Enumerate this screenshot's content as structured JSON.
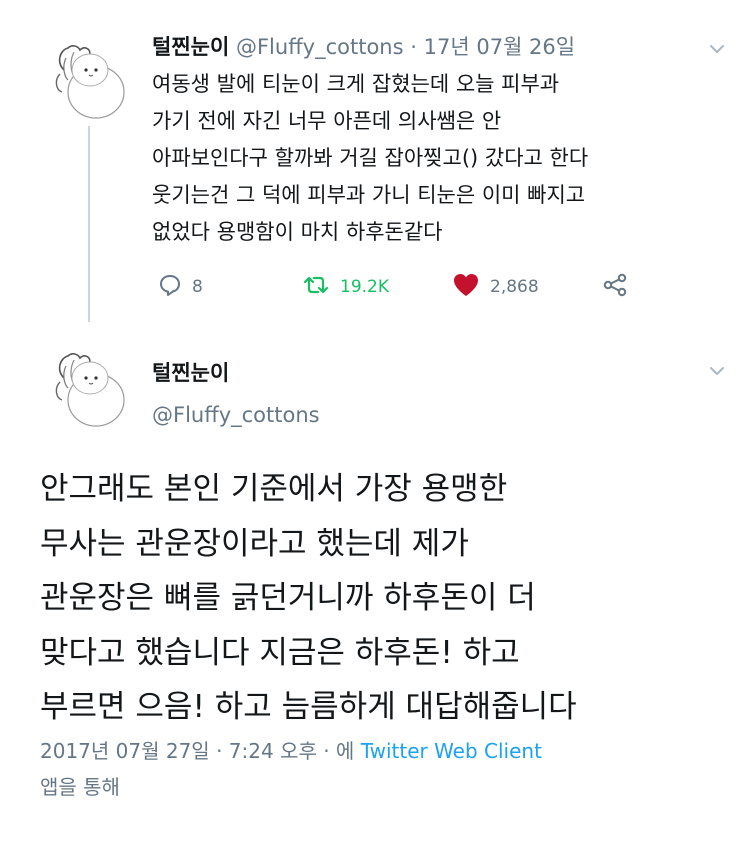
{
  "tweet1": {
    "name": "털찐눈이",
    "handle": "@Fluffy_cottons",
    "separator": "·",
    "date": "17년 07월 26일",
    "lines": [
      "여동생 발에 티눈이 크게 잡혔는데 오늘 피부과",
      "가기 전에 자긴 너무 아픈데 의사쌤은 안",
      "아파보인다구 할까봐 거길 잡아찢고() 갔다고 한다",
      "웃기는건 그 덕에 피부과 가니 티눈은 이미 빠지고",
      "없었다 용맹함이 마치 하후돈같다"
    ],
    "actions": {
      "reply_count": "8",
      "retweet_count": "19.2K",
      "like_count": "2,868"
    },
    "colors": {
      "retweet": "#17bf63",
      "like": "#c4122e"
    }
  },
  "tweet2": {
    "name": "털찐눈이",
    "handle": "@Fluffy_cottons",
    "lines": [
      "안그래도 본인 기준에서 가장 용맹한",
      "무사는 관운장이라고 했는데 제가",
      "관운장은 뼈를 긁던거니까 하후돈이 더",
      "맞다고 했습니다 지금은 하후돈! 하고",
      "부르면 으음! 하고 늠름하게 대답해줍니다"
    ],
    "meta": {
      "timestamp": "2017년 07월 27일 · 7:24 오후 · 에",
      "client": "Twitter Web Client",
      "suffix": "앱을 통해"
    }
  },
  "icons": [
    "reply-icon",
    "retweet-icon",
    "heart-icon",
    "share-icon",
    "chevron-down-icon",
    "avatar"
  ]
}
